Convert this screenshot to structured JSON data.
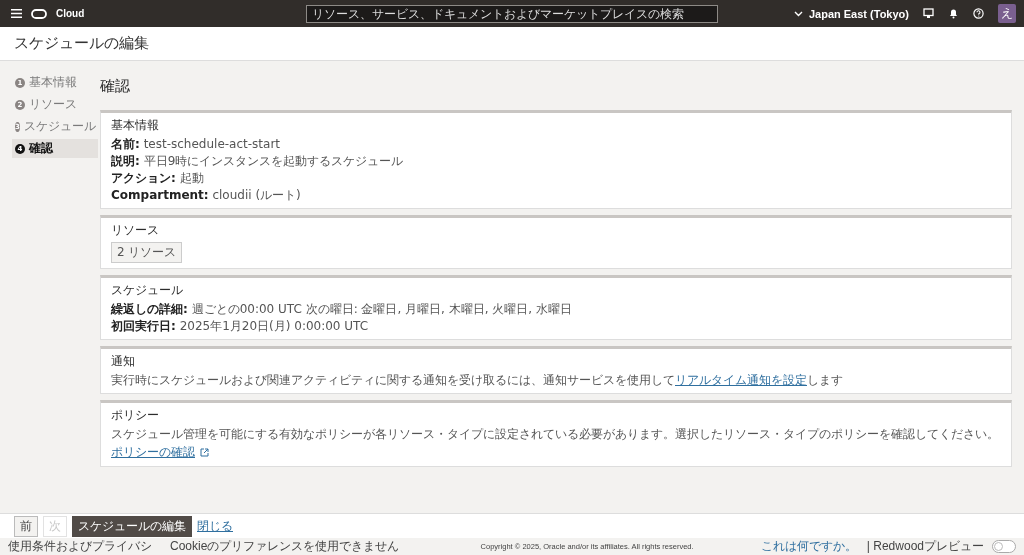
{
  "header": {
    "brand": "Cloud",
    "search": {
      "placeholder": "リソース、サービス、ドキュメントおよびマーケットプレイスの検索"
    },
    "region": "Japan East (Tokyo)",
    "avatar": "え"
  },
  "page_title": "スケジュールの編集",
  "steps": [
    {
      "number": "1",
      "label": "基本情報",
      "selected": false
    },
    {
      "number": "2",
      "label": "リソース",
      "selected": false
    },
    {
      "number": "3",
      "label": "スケジュール",
      "selected": false
    },
    {
      "number": "4",
      "label": "確認",
      "selected": true
    }
  ],
  "heading": "確認",
  "sections": [
    {
      "title": "基本情報",
      "lines": [
        "**名前:** test-schedule-act-start",
        "**説明:** 平日9時にインスタンスを起動するスケジュール",
        "**アクション:** 起動",
        "**Compartment:** cloudii (ルート)"
      ]
    },
    {
      "title": "リソース",
      "chip": "2 リソース"
    },
    {
      "title": "スケジュール",
      "lines": [
        "**繰返しの詳細:** 週ごとの00:00 UTC 次の曜日: 金曜日, 月曜日, 木曜日, 火曜日, 水曜日",
        "**初回実行日:** 2025年1月20日(月) 0:00:00 UTC"
      ]
    },
    {
      "title": "通知",
      "text": "実行時にスケジュールおよび関連アクティビティに関する通知を受け取るには、通知サービスを使用して",
      "link": "リアルタイム通知を設定",
      "text_after": "します"
    },
    {
      "title": "ポリシー",
      "text": "スケジュール管理を可能にする有効なポリシーが各リソース・タイプに設定されている必要があります。選択したリソース・タイプのポリシーを確認してください。",
      "external_link": "ポリシーの確認"
    }
  ],
  "actions": [
    {
      "label": "前",
      "kind": "secondary",
      "disabled": false
    },
    {
      "label": "次",
      "kind": "secondary",
      "disabled": true
    },
    {
      "label": "スケジュールの編集",
      "kind": "primary",
      "disabled": false
    },
    {
      "label": "閉じる",
      "kind": "link"
    }
  ],
  "footer": {
    "terms": "使用条件およびプライバシ",
    "cookie": "Cookieのプリファレンスを使用できません",
    "copyright": "Copyright © 2025, Oracle and/or its affiliates. All rights reserved.",
    "help_link": "これは何ですか。",
    "preview_label": "| Redwoodプレビュー",
    "preview_on": false
  }
}
